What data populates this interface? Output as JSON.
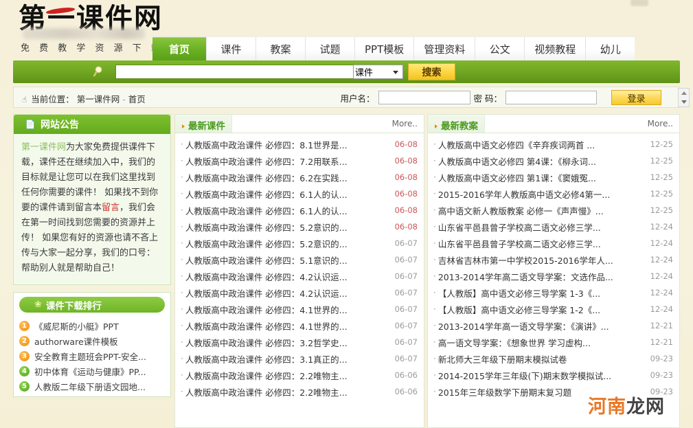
{
  "site": {
    "logo_text": "第一课件网",
    "tagline": "免 费 教 学 资 源 下 载 基 地"
  },
  "nav": {
    "tabs": [
      {
        "label": "首页",
        "active": true
      },
      {
        "label": "课件",
        "active": false
      },
      {
        "label": "教案",
        "active": false
      },
      {
        "label": "试题",
        "active": false
      },
      {
        "label": "PPT模板",
        "active": false
      },
      {
        "label": "管理资料",
        "active": false
      },
      {
        "label": "公文",
        "active": false
      },
      {
        "label": "视频教程",
        "active": false
      },
      {
        "label": "幼儿",
        "active": false
      }
    ]
  },
  "search": {
    "icon": "search-icon",
    "value": "",
    "placeholder": "",
    "category_selected": "课件",
    "button_label": "搜索"
  },
  "crumb": {
    "icon": "hand-pointer-icon",
    "prefix": "当前位置：",
    "path_root": "第一课件网",
    "separator": "-",
    "path_current": "首页"
  },
  "login": {
    "user_label": "用户名：",
    "user_value": "",
    "pass_label": "密 码：",
    "pass_value": "",
    "button_label": "登录"
  },
  "sidebar": {
    "notice": {
      "icon": "document-icon",
      "title": "网站公告",
      "line1_link": "第一课件网",
      "line1_rest": "为大家免费提供课件下载，课件还在继续加入中，我们的目标就是让您可以在我们这里找到任何你需要的课件！",
      "line2_pre": "如果找不到你要的课件请到留言本",
      "line2_link": "留言",
      "line2_rest": "，我们会在第一时间找到您需要的资源并上传！",
      "line3": "如果您有好的资源也请不吝上传与大家一起分享，我们的口号：帮助别人就是帮助自己！"
    },
    "ranking": {
      "icon": "flower-icon",
      "title": "课件下载排行",
      "items": [
        {
          "num": "1",
          "color": "orange",
          "label": "《威尼斯的小艇》PPT"
        },
        {
          "num": "2",
          "color": "orange",
          "label": "authorware课件模板"
        },
        {
          "num": "3",
          "color": "orange",
          "label": "安全教育主题班会PPT-安全..."
        },
        {
          "num": "4",
          "color": "green",
          "label": "初中体育《运动与健康》PP..."
        },
        {
          "num": "5",
          "color": "green",
          "label": "人教版二年级下册语文园地..."
        }
      ]
    }
  },
  "columns": [
    {
      "id": "latest-courseware",
      "title": "最新课件",
      "more_label": "More..",
      "items": [
        {
          "text": "人教版高中政治课件 必修四：8.1世界是...",
          "date": "06-08",
          "hot": true
        },
        {
          "text": "人教版高中政治课件 必修四：7.2用联系...",
          "date": "06-08",
          "hot": true
        },
        {
          "text": "人教版高中政治课件 必修四：6.2在实践...",
          "date": "06-08",
          "hot": true
        },
        {
          "text": "人教版高中政治课件 必修四：6.1人的认...",
          "date": "06-08",
          "hot": true
        },
        {
          "text": "人教版高中政治课件 必修四：6.1人的认...",
          "date": "06-08",
          "hot": true
        },
        {
          "text": "人教版高中政治课件 必修四：5.2意识的...",
          "date": "06-08",
          "hot": true
        },
        {
          "text": "人教版高中政治课件 必修四：5.2意识的...",
          "date": "06-07",
          "hot": false
        },
        {
          "text": "人教版高中政治课件 必修四：5.1意识的...",
          "date": "06-07",
          "hot": false
        },
        {
          "text": "人教版高中政治课件 必修四：4.2认识运...",
          "date": "06-07",
          "hot": false
        },
        {
          "text": "人教版高中政治课件 必修四：4.2认识运...",
          "date": "06-07",
          "hot": false
        },
        {
          "text": "人教版高中政治课件 必修四：4.1世界的...",
          "date": "06-07",
          "hot": false
        },
        {
          "text": "人教版高中政治课件 必修四：4.1世界的...",
          "date": "06-07",
          "hot": false
        },
        {
          "text": "人教版高中政治课件 必修四：3.2哲学史...",
          "date": "06-07",
          "hot": false
        },
        {
          "text": "人教版高中政治课件 必修四：3.1真正的...",
          "date": "06-07",
          "hot": false
        },
        {
          "text": "人教版高中政治课件 必修四：2.2唯物主...",
          "date": "06-06",
          "hot": false
        },
        {
          "text": "人教版高中政治课件 必修四：2.2唯物主...",
          "date": "06-06",
          "hot": false
        }
      ]
    },
    {
      "id": "latest-lesson-plans",
      "title": "最新教案",
      "more_label": "More..",
      "items": [
        {
          "text": "人教版高中语文必修四《辛弃疾词两首 ...",
          "date": "12-25",
          "hot": false
        },
        {
          "text": "人教版高中语文必修四 第4课：《柳永词...",
          "date": "12-25",
          "hot": false
        },
        {
          "text": "人教版高中语文必修四 第1课：《窦娥冤...",
          "date": "12-25",
          "hot": false
        },
        {
          "text": "2015-2016学年人教版高中语文必修4第一...",
          "date": "12-25",
          "hot": false
        },
        {
          "text": "高中语文新人教版教案 必修一《声声慢》...",
          "date": "12-25",
          "hot": false
        },
        {
          "text": "山东省平邑县曾子学校高二语文必修三学...",
          "date": "12-24",
          "hot": false
        },
        {
          "text": "山东省平邑县曾子学校高二语文必修三学...",
          "date": "12-24",
          "hot": false
        },
        {
          "text": "吉林省吉林市第一中学校2015-2016学年人...",
          "date": "12-24",
          "hot": false
        },
        {
          "text": "2013-2014学年高二语文导学案：文选作品...",
          "date": "12-24",
          "hot": false
        },
        {
          "text": "【人教版】高中语文必修三导学案 1-3《...",
          "date": "12-24",
          "hot": false
        },
        {
          "text": "【人教版】高中语文必修三导学案 1-2《...",
          "date": "12-24",
          "hot": false
        },
        {
          "text": "2013-2014学年高一语文导学案：《演讲》...",
          "date": "12-21",
          "hot": false
        },
        {
          "text": "高一语文导学案：《想象世界 学习虚构...",
          "date": "12-21",
          "hot": false
        },
        {
          "text": "新北师大三年级下册期末模拟试卷",
          "date": "09-23",
          "hot": false
        },
        {
          "text": "2014-2015学年三年级(下)期末数学模拟试...",
          "date": "09-23",
          "hot": false
        },
        {
          "text": "2015年三年级数学下册期末复习题",
          "date": "09-23",
          "hot": false
        }
      ]
    }
  ],
  "watermark": {
    "part_orange": "河南",
    "part_dark": "龙网"
  },
  "colors": {
    "accent_green": "#6fb526",
    "header_cream": "#f6f0da",
    "hot_red": "#cc5555",
    "btn_yellow": "#fcd949",
    "watermark_orange": "#e8701a"
  }
}
